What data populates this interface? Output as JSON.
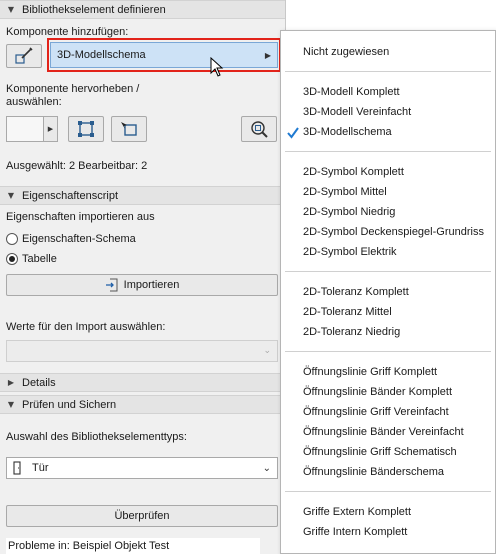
{
  "panel": {
    "section_definieren": "Bibliothekselement definieren",
    "komponente_label": "Komponente hinzufügen:",
    "component_dropdown_value": "3D-Modellschema",
    "hervorheben_label_line1": "Komponente hervorheben /",
    "hervorheben_label_line2": "auswählen:",
    "selection_status": "Ausgewählt: 2 Bearbeitbar: 2",
    "section_script": "Eigenschaftenscript",
    "import_label": "Eigenschaften importieren aus",
    "radio_schema": "Eigenschaften-Schema",
    "radio_tabelle": "Tabelle",
    "import_button": "Importieren",
    "werte_label": "Werte für den Import auswählen:",
    "werte_value": "",
    "section_details": "Details",
    "section_pruefen": "Prüfen und Sichern",
    "typ_label": "Auswahl des Bibliothekselementtyps:",
    "typ_value": "Tür",
    "pruefen_button": "Überprüfen",
    "probleme_text": "Probleme in: Beispiel Objekt Test"
  },
  "menu": {
    "items": [
      "Nicht zugewiesen",
      "3D-Modell Komplett",
      "3D-Modell Vereinfacht",
      "3D-Modellschema",
      "2D-Symbol Komplett",
      "2D-Symbol Mittel",
      "2D-Symbol Niedrig",
      "2D-Symbol Deckenspiegel-Grundriss",
      "2D-Symbol Elektrik",
      "2D-Toleranz Komplett",
      "2D-Toleranz Mittel",
      "2D-Toleranz Niedrig",
      "Öffnungslinie Griff Komplett",
      "Öffnungslinie Bänder Komplett",
      "Öffnungslinie Griff Vereinfacht",
      "Öffnungslinie Bänder Vereinfacht",
      "Öffnungslinie Griff Schematisch",
      "Öffnungslinie Bänderschema",
      "Griffe Extern Komplett",
      "Griffe Intern Komplett"
    ],
    "checked_item": "3D-Modellschema"
  },
  "colors": {
    "highlight_border": "#e2231a",
    "dropdown_fill": "#cde2f6",
    "check_mark": "#1f7ad1"
  },
  "icons": [
    "collapse-triangle-icon",
    "pen-edit-icon",
    "chevron-right-icon",
    "select-bounds-icon",
    "select-corner-icon",
    "zoom-select-icon",
    "checkmark-icon",
    "cursor-arrow-icon",
    "import-icon",
    "door-icon",
    "chevron-down-icon"
  ]
}
